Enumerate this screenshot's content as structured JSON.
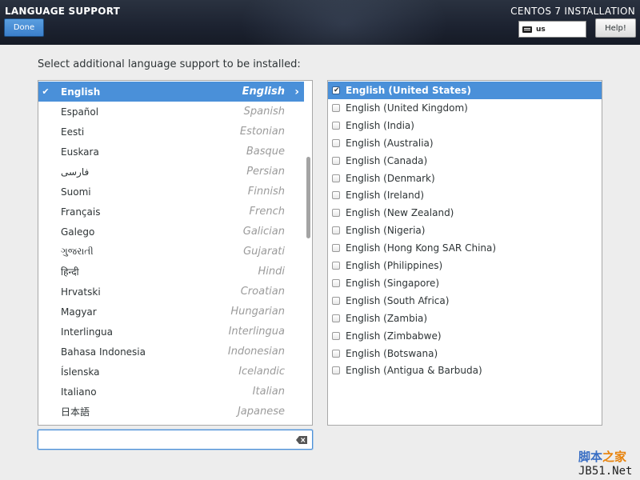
{
  "header": {
    "spoke_title": "LANGUAGE SUPPORT",
    "done_label": "Done",
    "product_title": "CENTOS 7 INSTALLATION",
    "keyboard_layout": "us",
    "help_label": "Help!",
    "colors": {
      "header_bg": "#1c2230",
      "accent": "#4a90d9"
    }
  },
  "prompt": "Select additional language support to be installed:",
  "languages": [
    {
      "native": "English",
      "english": "English",
      "selected": true,
      "checked": true
    },
    {
      "native": "Español",
      "english": "Spanish"
    },
    {
      "native": "Eesti",
      "english": "Estonian"
    },
    {
      "native": "Euskara",
      "english": "Basque"
    },
    {
      "native": "فارسی",
      "english": "Persian"
    },
    {
      "native": "Suomi",
      "english": "Finnish"
    },
    {
      "native": "Français",
      "english": "French"
    },
    {
      "native": "Galego",
      "english": "Galician"
    },
    {
      "native": "ગુજરાતી",
      "english": "Gujarati"
    },
    {
      "native": "हिन्दी",
      "english": "Hindi"
    },
    {
      "native": "Hrvatski",
      "english": "Croatian"
    },
    {
      "native": "Magyar",
      "english": "Hungarian"
    },
    {
      "native": "Interlingua",
      "english": "Interlingua"
    },
    {
      "native": "Bahasa Indonesia",
      "english": "Indonesian"
    },
    {
      "native": "Íslenska",
      "english": "Icelandic"
    },
    {
      "native": "Italiano",
      "english": "Italian"
    },
    {
      "native": "日本語",
      "english": "Japanese"
    }
  ],
  "locales": [
    {
      "label": "English (United States)",
      "checked": true,
      "selected": true
    },
    {
      "label": "English (United Kingdom)"
    },
    {
      "label": "English (India)"
    },
    {
      "label": "English (Australia)"
    },
    {
      "label": "English (Canada)"
    },
    {
      "label": "English (Denmark)"
    },
    {
      "label": "English (Ireland)"
    },
    {
      "label": "English (New Zealand)"
    },
    {
      "label": "English (Nigeria)"
    },
    {
      "label": "English (Hong Kong SAR China)"
    },
    {
      "label": "English (Philippines)"
    },
    {
      "label": "English (Singapore)"
    },
    {
      "label": "English (South Africa)"
    },
    {
      "label": "English (Zambia)"
    },
    {
      "label": "English (Zimbabwe)"
    },
    {
      "label": "English (Botswana)"
    },
    {
      "label": "English (Antigua & Barbuda)"
    }
  ],
  "search": {
    "value": "",
    "placeholder": ""
  },
  "watermark": {
    "top_blue": "脚本",
    "top_orange": "之家",
    "bottom": "JB51.Net"
  }
}
